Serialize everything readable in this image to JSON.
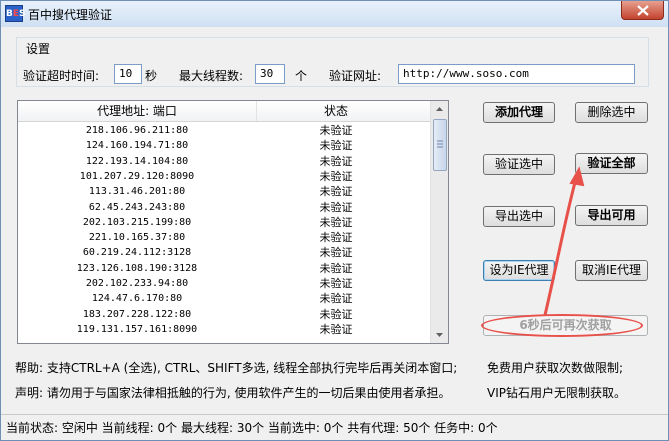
{
  "window": {
    "title": "百中搜代理验证",
    "icon_text_b": "B",
    "icon_text_s": "S"
  },
  "settings": {
    "group_title": "设置",
    "timeout_label": "验证超时时间:",
    "timeout_value": "10",
    "timeout_unit": "秒",
    "threads_label": "最大线程数:",
    "threads_value": "30",
    "threads_unit": "个",
    "url_label": "验证网址:",
    "url_value": "http://www.soso.com"
  },
  "list": {
    "col_address": "代理地址: 端口",
    "col_status": "状态",
    "rows": [
      {
        "address": "218.106.96.211:80",
        "status": "未验证"
      },
      {
        "address": "124.160.194.71:80",
        "status": "未验证"
      },
      {
        "address": "122.193.14.104:80",
        "status": "未验证"
      },
      {
        "address": "101.207.29.120:8090",
        "status": "未验证"
      },
      {
        "address": "113.31.46.201:80",
        "status": "未验证"
      },
      {
        "address": "62.45.243.243:80",
        "status": "未验证"
      },
      {
        "address": "202.103.215.199:80",
        "status": "未验证"
      },
      {
        "address": "221.10.165.37:80",
        "status": "未验证"
      },
      {
        "address": "60.219.24.112:3128",
        "status": "未验证"
      },
      {
        "address": "123.126.108.190:3128",
        "status": "未验证"
      },
      {
        "address": "202.102.233.94:80",
        "status": "未验证"
      },
      {
        "address": "124.47.6.170:80",
        "status": "未验证"
      },
      {
        "address": "183.207.228.122:80",
        "status": "未验证"
      },
      {
        "address": "119.131.157.161:8090",
        "status": "未验证"
      }
    ]
  },
  "buttons": {
    "add_proxy": "添加代理",
    "delete_selected": "删除选中",
    "verify_selected": "验证选中",
    "verify_all": "验证全部",
    "export_selected": "导出选中",
    "export_usable": "导出可用",
    "set_ie_proxy": "设为IE代理",
    "cancel_ie_proxy": "取消IE代理",
    "refetch": "6秒后可再次获取"
  },
  "help": {
    "help_text": "帮助: 支持CTRL+A (全选), CTRL、SHIFT多选, 线程全部执行完毕后再关闭本窗口;",
    "statement_text": "声明: 请勿用于与国家法律相抵触的行为, 使用软件产生的一切后果由使用者承担。",
    "free_user_note": "免费用户获取次数做限制;",
    "vip_user_note": "VIP钻石用户无限制获取。"
  },
  "statusbar": {
    "text": "当前状态: 空闲中  当前线程: 0个  最大线程: 30个  当前选中: 0个  共有代理: 50个  任务中: 0个"
  },
  "colors": {
    "annotation_red": "#e8504a",
    "title_bar": "#cfe0f3",
    "close_button": "#c2432e"
  }
}
